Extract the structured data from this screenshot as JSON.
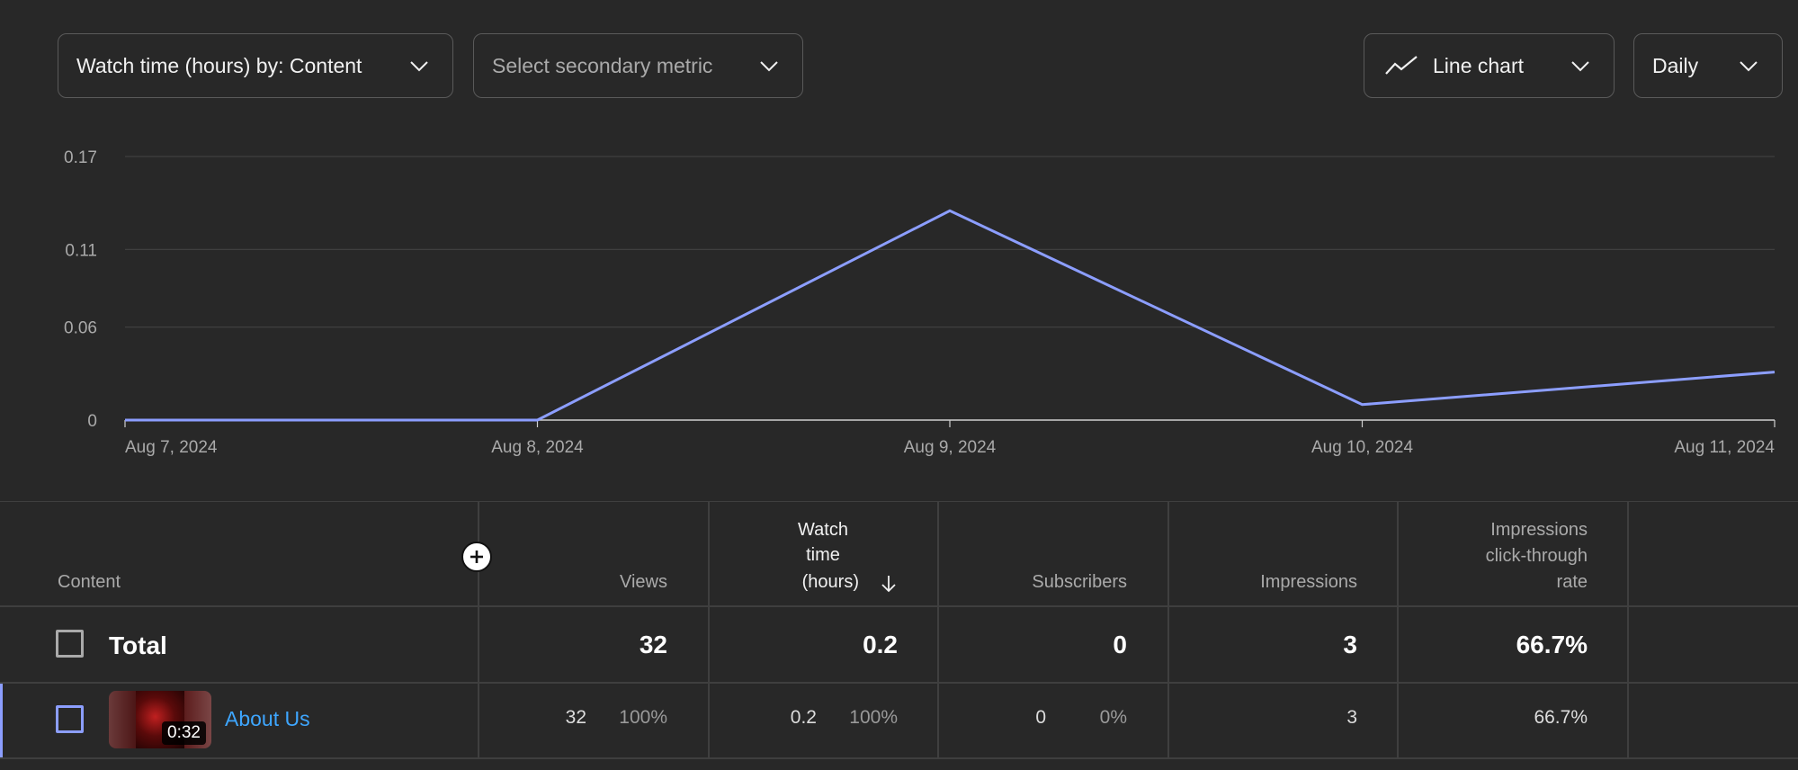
{
  "toolbar": {
    "primary_metric": "Watch time (hours) by: Content",
    "secondary_metric_placeholder": "Select secondary metric",
    "chart_type": "Line chart",
    "interval": "Daily"
  },
  "colors": {
    "background": "#282828",
    "series_line": "#8c9eff",
    "link": "#3ea6ff",
    "gridline": "#3f3f3f"
  },
  "chart_data": {
    "type": "line",
    "x": [
      "Aug 7, 2024",
      "Aug 8, 2024",
      "Aug 9, 2024",
      "Aug 10, 2024",
      "Aug 11, 2024"
    ],
    "series": [
      {
        "values": [
          0,
          0,
          0.135,
          0.01,
          0.031
        ]
      }
    ],
    "yticks": [
      "0.17",
      "0.11",
      "0.06",
      "0"
    ],
    "ylim": [
      0,
      0.17
    ],
    "grid": true,
    "legend": "none"
  },
  "table": {
    "headers": {
      "content": "Content",
      "views": "Views",
      "watch_time_line1": "Watch",
      "watch_time_line2": "time",
      "watch_time_line3": "(hours)",
      "sort_icon": "arrow-down-icon",
      "subscribers": "Subscribers",
      "impressions": "Impressions",
      "ctr_line1": "Impressions",
      "ctr_line2": "click-through",
      "ctr_line3": "rate"
    },
    "total": {
      "label": "Total",
      "views": "32",
      "watch_time": "0.2",
      "subscribers": "0",
      "impressions": "3",
      "ctr": "66.7%"
    },
    "rows": [
      {
        "duration": "0:32",
        "title": "About Us",
        "views": "32",
        "views_pct": "100%",
        "watch_time": "0.2",
        "watch_time_pct": "100%",
        "subscribers": "0",
        "subscribers_pct": "0%",
        "impressions": "3",
        "ctr": "66.7%"
      }
    ]
  }
}
